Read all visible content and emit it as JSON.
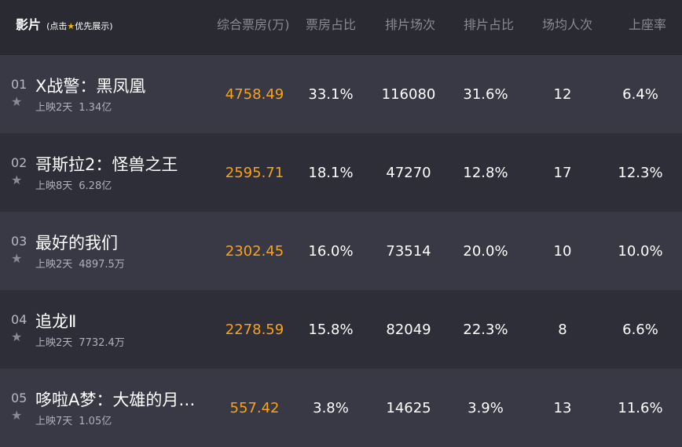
{
  "header": {
    "film": "影片",
    "hint_prefix": "(点击",
    "hint_suffix": "优先展示)",
    "columns": [
      "综合票房(万)",
      "票房占比",
      "排片场次",
      "排片占比",
      "场均人次",
      "上座率"
    ]
  },
  "colors": {
    "accent": "#f7a31c",
    "row_odd": "#393945",
    "row_even": "#2e2e38"
  },
  "rows": [
    {
      "rank": "01",
      "name": "X战警：黑凤凰",
      "days": "上映2天",
      "total": "1.34亿",
      "box_office": "4758.49",
      "box_share": "33.1%",
      "shows": "116080",
      "show_share": "31.6%",
      "avg_people": "12",
      "occupancy": "6.4%"
    },
    {
      "rank": "02",
      "name": "哥斯拉2：怪兽之王",
      "days": "上映8天",
      "total": "6.28亿",
      "box_office": "2595.71",
      "box_share": "18.1%",
      "shows": "47270",
      "show_share": "12.8%",
      "avg_people": "17",
      "occupancy": "12.3%"
    },
    {
      "rank": "03",
      "name": "最好的我们",
      "days": "上映2天",
      "total": "4897.5万",
      "box_office": "2302.45",
      "box_share": "16.0%",
      "shows": "73514",
      "show_share": "20.0%",
      "avg_people": "10",
      "occupancy": "10.0%"
    },
    {
      "rank": "04",
      "name": "追龙Ⅱ",
      "days": "上映2天",
      "total": "7732.4万",
      "box_office": "2278.59",
      "box_share": "15.8%",
      "shows": "82049",
      "show_share": "22.3%",
      "avg_people": "8",
      "occupancy": "6.6%"
    },
    {
      "rank": "05",
      "name": "哆啦A梦：大雄的月…",
      "days": "上映7天",
      "total": "1.05亿",
      "box_office": "557.42",
      "box_share": "3.8%",
      "shows": "14625",
      "show_share": "3.9%",
      "avg_people": "13",
      "occupancy": "11.6%"
    }
  ]
}
